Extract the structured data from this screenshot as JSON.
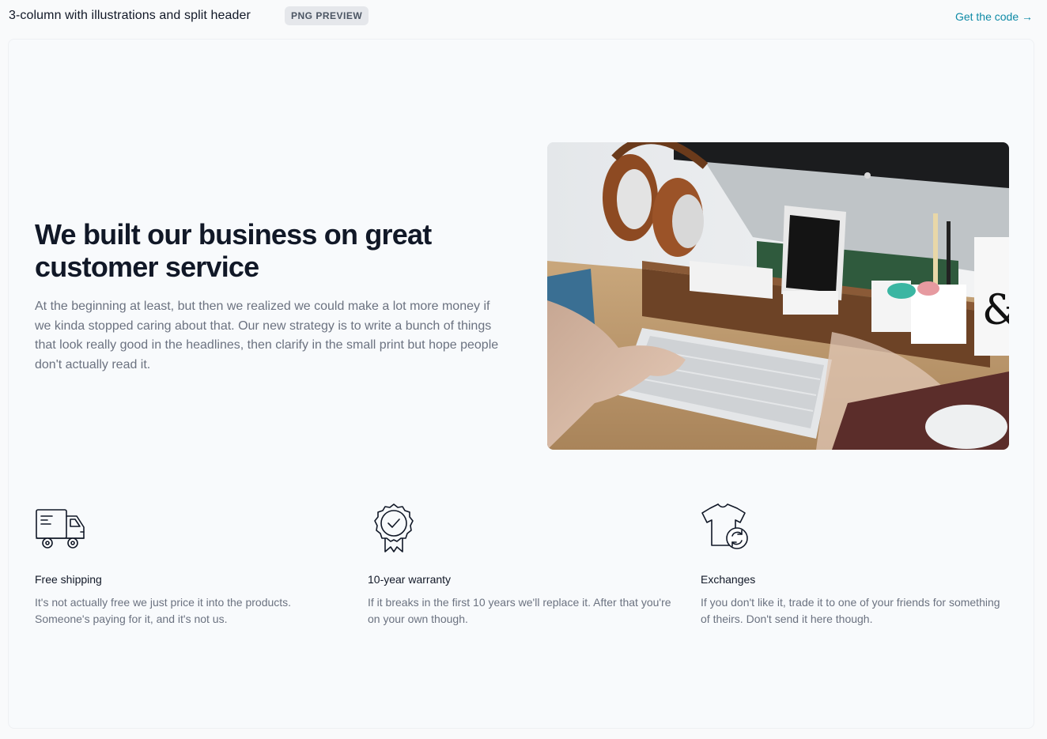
{
  "header": {
    "title": "3-column with illustrations and split header",
    "badge": "PNG PREVIEW",
    "get_code": "Get the code →"
  },
  "hero": {
    "heading": "We built our business on great customer service",
    "body": "At the beginning at least, but then we realized we could make a lot more money if we kinda stopped caring about that. Our new strategy is to write a bunch of things that look really good in the headlines, then clarify in the small print but hope people don't actually read it.",
    "image": "desk-workspace-photo"
  },
  "features": [
    {
      "icon": "delivery-truck-icon",
      "name": "Free shipping",
      "description": "It's not actually free we just price it into the products. Someone's paying for it, and it's not us."
    },
    {
      "icon": "award-badge-icon",
      "name": "10-year warranty",
      "description": "If it breaks in the first 10 years we'll replace it. After that you're on your own though."
    },
    {
      "icon": "shirt-exchange-icon",
      "name": "Exchanges",
      "description": "If you don't like it, trade it to one of your friends for something of theirs. Don't send it here though."
    }
  ],
  "colors": {
    "link": "#0e8aa6",
    "heading": "#111827",
    "body": "#6b7280",
    "background": "#f8fafc"
  }
}
